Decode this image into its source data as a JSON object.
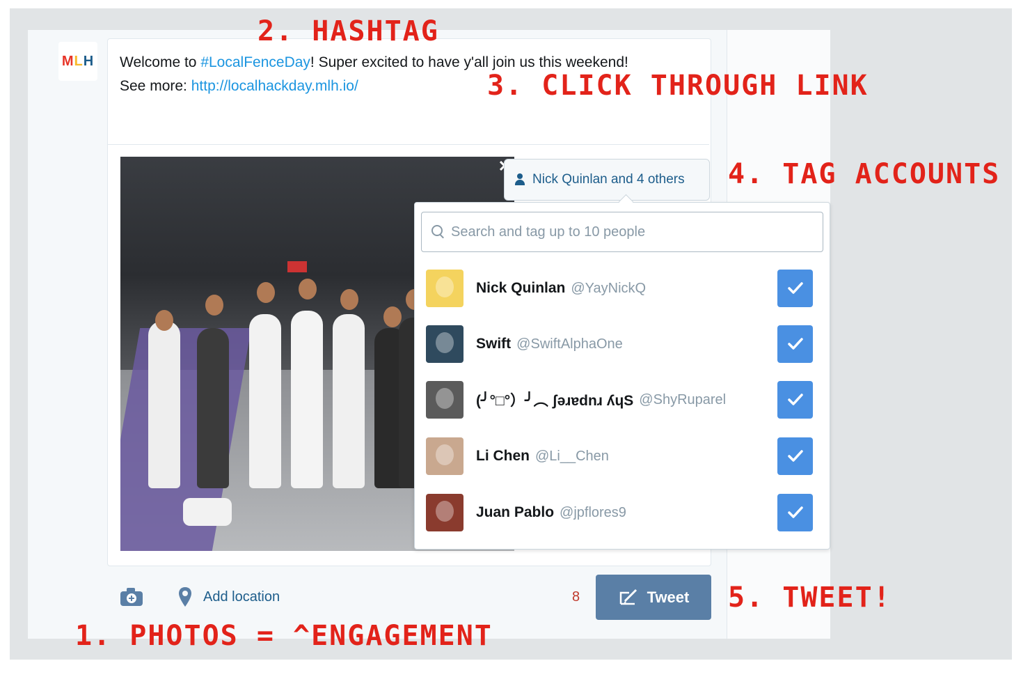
{
  "tweet": {
    "text_before": "Welcome to ",
    "hashtag": "#LocalFenceDay",
    "text_middle": "! Super excited to have y'all join us this weekend! See more: ",
    "link": "http://localhackday.mlh.io/"
  },
  "account_avatar": {
    "logo_m": "M",
    "logo_l": "L",
    "logo_h": "H"
  },
  "media": {
    "tag_button_label": "Nick Quinlan and 4 others",
    "close_glyph": "✕"
  },
  "tag_popover": {
    "search_placeholder": "Search and tag up to 10 people",
    "users": [
      {
        "name": "Nick Quinlan",
        "handle": "@YayNickQ",
        "checked": true,
        "avatar_color": "#f4d35e"
      },
      {
        "name": "Swift",
        "handle": "@SwiftAlphaOne",
        "checked": true,
        "avatar_color": "#2f4a5e"
      },
      {
        "name": "(╯°□°）╯︵ ʃǝɹɐdnɹ ʎɥS",
        "handle": "@ShyRuparel",
        "checked": true,
        "avatar_color": "#5b5b5b"
      },
      {
        "name": "Li Chen",
        "handle": "@Li__Chen",
        "checked": true,
        "avatar_color": "#c9a88f"
      },
      {
        "name": "Juan Pablo",
        "handle": "@jpflores9",
        "checked": true,
        "avatar_color": "#8a3b2e"
      }
    ]
  },
  "toolbar": {
    "add_location_label": "Add location",
    "char_count": "8",
    "tweet_label": "Tweet"
  },
  "annotations": {
    "hashtag": "2. HASHTAG",
    "link": "3. CLICK THROUGH LINK",
    "tag": "4. TAG ACCOUNTS",
    "photos": "1. PHOTOS = ^ENGAGEMENT",
    "tweet": "5. TWEET!"
  },
  "colors": {
    "annotation_red": "#e2231a",
    "link_blue": "#1b95e0",
    "check_blue": "#4a90e2",
    "tweet_button": "#5a7fa6"
  }
}
